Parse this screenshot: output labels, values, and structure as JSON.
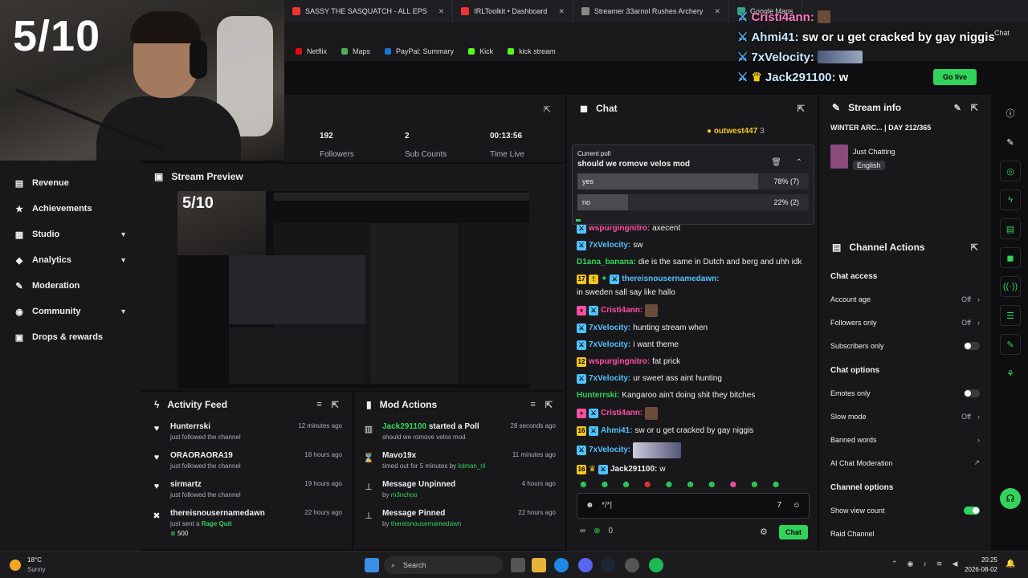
{
  "overlay": {
    "score": "5/10",
    "messages": [
      {
        "user": "Cristi4ann:",
        "text": ""
      },
      {
        "user": "Ahmi41:",
        "text": "sw or u get cracked by gay niggis"
      },
      {
        "user": "7xVelocity:",
        "text": ""
      },
      {
        "user": "Jack291100:",
        "text": "w"
      }
    ]
  },
  "browser": {
    "tabs": [
      {
        "title": "SASSY THE SASQUATCH - ALL EPS",
        "color": "#e33"
      },
      {
        "title": "IRLToolkit • Dashboard",
        "color": "#e33"
      },
      {
        "title": "Streamer 33arnol Rushes Archery",
        "color": "#888"
      },
      {
        "title": "Google Maps",
        "color": "#3a8"
      }
    ],
    "bookmarks": [
      {
        "label": "Netflix",
        "color": "#e50914"
      },
      {
        "label": "Maps",
        "color": "#4caf50"
      },
      {
        "label": "PayPal: Summary",
        "color": "#1976d2"
      },
      {
        "label": "Kick",
        "color": "#53fc18"
      },
      {
        "label": "kick stream",
        "color": "#53fc18"
      }
    ],
    "profile_label": "Chat",
    "go_live": "Go live"
  },
  "sidebar": {
    "items": [
      {
        "label": "Revenue",
        "icon": "▤",
        "chev": ""
      },
      {
        "label": "Achievements",
        "icon": "🏆",
        "chev": ""
      },
      {
        "label": "Studio",
        "icon": "▦",
        "chev": "▼"
      },
      {
        "label": "Analytics",
        "icon": "⚙",
        "chev": "▼"
      },
      {
        "label": "Moderation",
        "icon": "✎",
        "chev": ""
      },
      {
        "label": "Community",
        "icon": "◉",
        "chev": "▼"
      },
      {
        "label": "Drops & rewards",
        "icon": "▣",
        "chev": ""
      }
    ]
  },
  "stats": {
    "followers": {
      "value": "192",
      "label": "Followers"
    },
    "subs": {
      "value": "2",
      "label": "Sub Counts"
    },
    "time": {
      "value": "00:13:56",
      "label": "Time Live"
    }
  },
  "preview": {
    "title": "Stream Preview",
    "score": "5/10"
  },
  "activity": {
    "title": "Activity Feed",
    "rows": [
      {
        "icon": "♥",
        "name": "Hunterrski",
        "sub": "just followed the channel",
        "time": "12 minutes ago",
        "extra": ""
      },
      {
        "icon": "♥",
        "name": "ORAORAORA19",
        "sub": "just followed the channel",
        "time": "18 hours ago",
        "extra": ""
      },
      {
        "icon": "♥",
        "name": "sirmartz",
        "sub": "just followed the channel",
        "time": "19 hours ago",
        "extra": ""
      },
      {
        "icon": "✖",
        "name": "thereisnousernamedawn",
        "sub": "just sent a",
        "time": "22 hours ago",
        "extra": "Rage Quit",
        "amount": "500"
      }
    ]
  },
  "modactions": {
    "title": "Mod Actions",
    "rows": [
      {
        "icon": "▥",
        "name": "Jack291100",
        "action": "started a Poll",
        "sub": "should we romove velos mod",
        "time": "28 seconds ago",
        "by": ""
      },
      {
        "icon": "⌛",
        "name": "Mavo19x",
        "action": "",
        "sub": "timed out for 5 minutes by",
        "time": "11 minutes ago",
        "by": "lolman_nl"
      },
      {
        "icon": "📌",
        "name": "Message Unpinned",
        "action": "",
        "sub": "by",
        "time": "4 hours ago",
        "by": "m3nchoo"
      },
      {
        "icon": "📌",
        "name": "Message Pinned",
        "action": "",
        "sub": "by",
        "time": "22 hours ago",
        "by": "thereisnousernamedawn"
      }
    ]
  },
  "chat": {
    "title": "Chat",
    "pinned_user": "outwest447",
    "pinned_count": "3",
    "poll": {
      "label": "Current poll",
      "question": "should we romove velos mod",
      "options": [
        {
          "label": "yes",
          "pct": "78% (7)",
          "fill": 78
        },
        {
          "label": "no",
          "pct": "22% (2)",
          "fill": 22
        }
      ]
    },
    "partial_top": "axecent",
    "messages": [
      {
        "user": "7xVelocity:",
        "cls": "u-blue",
        "text": "sw",
        "badge": ""
      },
      {
        "user": "D1ana_banana:",
        "cls": "u-green",
        "text": "die is the same in Dutch and berg and uhh idk",
        "badge": ""
      },
      {
        "user": "thereisnousernamedawn:",
        "cls": "u-blue",
        "text": "in sweden sall say like hallo",
        "badge": "17"
      },
      {
        "user": "Cristi4ann:",
        "cls": "u-pink",
        "text": "",
        "badge": ""
      },
      {
        "user": "7xVelocity:",
        "cls": "u-blue",
        "text": "hunting stream when",
        "badge": ""
      },
      {
        "user": "7xVelocity:",
        "cls": "u-blue",
        "text": "i want theme",
        "badge": ""
      },
      {
        "user": "wspurgingnitro:",
        "cls": "u-pink",
        "text": "fat prick",
        "badge": "12"
      },
      {
        "user": "7xVelocity:",
        "cls": "u-blue",
        "text": "ur sweet ass aint hunting",
        "badge": ""
      },
      {
        "user": "Hunterrski:",
        "cls": "u-green",
        "text": "Kangaroo ain't doing shit they bitches",
        "badge": ""
      },
      {
        "user": "Cristi4ann:",
        "cls": "u-pink",
        "text": "",
        "badge": ""
      },
      {
        "user": "Ahmi41:",
        "cls": "u-blue",
        "text": "sw or u get cracked by gay niggis",
        "badge": "16"
      },
      {
        "user": "7xVelocity:",
        "cls": "u-blue",
        "text": "",
        "badge": ""
      },
      {
        "user": "Jack291100:",
        "cls": "u-white",
        "text": "w",
        "badge": "16"
      }
    ],
    "input_value": "*/*|",
    "points": "0",
    "send_label": "Chat"
  },
  "stream_info": {
    "title": "Stream info",
    "stream_title": "WINTER ARC... | DAY 212/365",
    "category": "Just Chatting",
    "tag": "English"
  },
  "channel_actions": {
    "title": "Channel Actions",
    "chat_access": "Chat access",
    "account_age": {
      "label": "Account age",
      "value": "Off"
    },
    "followers_only": {
      "label": "Followers only",
      "value": "Off"
    },
    "subscribers_only": {
      "label": "Subscribers only"
    },
    "chat_options": "Chat options",
    "emotes_only": {
      "label": "Emotes only"
    },
    "slow_mode": {
      "label": "Slow mode",
      "value": "Off"
    },
    "banned_words": {
      "label": "Banned words"
    },
    "ai_moderation": {
      "label": "AI Chat Moderation"
    },
    "channel_options": "Channel options",
    "show_view_count": {
      "label": "Show view count"
    },
    "raid_channel": {
      "label": "Raid Channel"
    }
  },
  "taskbar": {
    "weather_temp": "18°C",
    "weather_desc": "Sunny",
    "search": "Search",
    "time": "20:25",
    "date": "2026-08-02"
  }
}
